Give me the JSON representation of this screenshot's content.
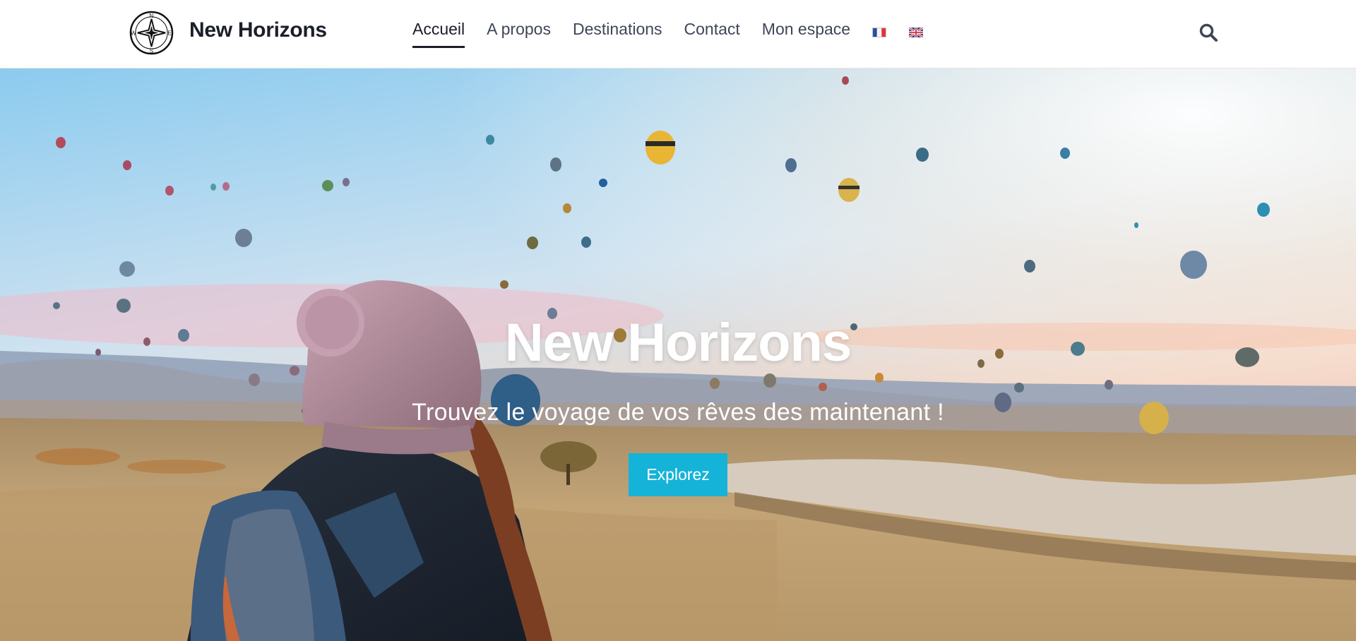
{
  "header": {
    "brand": "New Horizons",
    "logo_letters": {
      "n": "N",
      "s": "S",
      "e": "E",
      "w": "W"
    },
    "nav": [
      {
        "label": "Accueil",
        "active": true
      },
      {
        "label": "A propos"
      },
      {
        "label": "Destinations"
      },
      {
        "label": "Contact"
      },
      {
        "label": "Mon espace"
      }
    ],
    "languages": [
      "fr-flag-icon",
      "uk-flag-icon"
    ],
    "search_icon": "search-icon"
  },
  "hero": {
    "title": "New Horizons",
    "subtitle": "Trouvez le voyage de vos rêves des maintenant !",
    "cta": "Explorez",
    "accent_color": "#15b3d8"
  }
}
